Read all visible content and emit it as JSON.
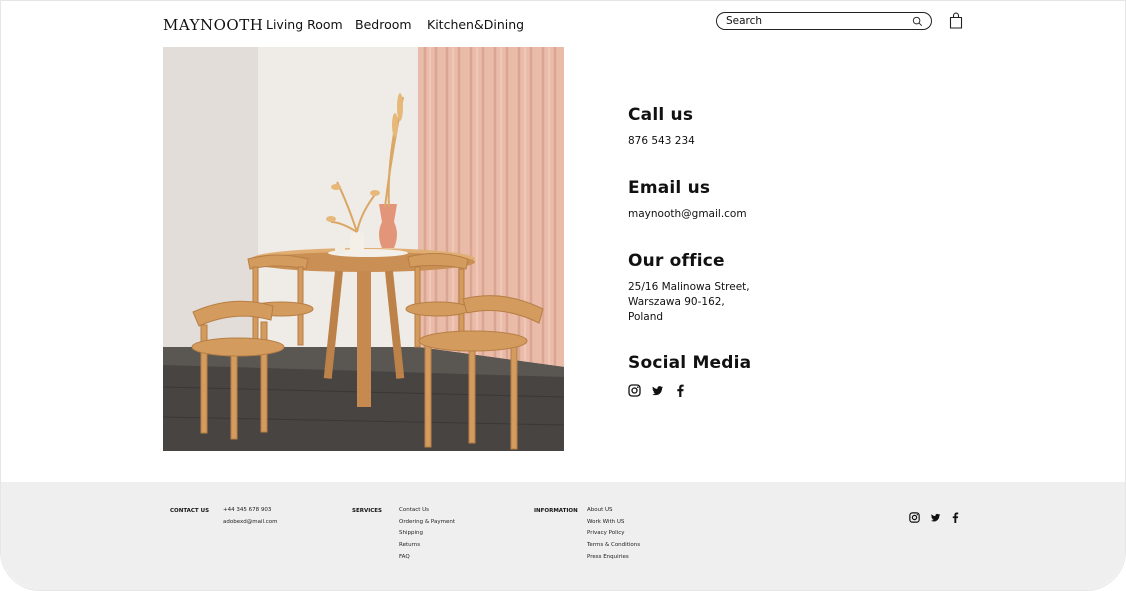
{
  "header": {
    "logo": "MAYNOOTH",
    "nav": [
      {
        "label": "Living Room"
      },
      {
        "label": "Bedroom"
      },
      {
        "label": "Kitchen&Dining"
      }
    ],
    "search": {
      "placeholder": "Search",
      "value": ""
    },
    "icons": {
      "search": "search-icon",
      "cart": "shopping-bag-icon"
    }
  },
  "contact": {
    "call": {
      "heading": "Call us",
      "value": "876 543 234"
    },
    "email": {
      "heading": "Email us",
      "value": "maynooth@gmail.com"
    },
    "office": {
      "heading": "Our office",
      "lines": [
        "25/16 Malinowa Street,",
        "Warszawa 90-162,",
        "Poland"
      ]
    },
    "social": {
      "heading": "Social Media",
      "icons": [
        "instagram-icon",
        "twitter-icon",
        "facebook-icon"
      ]
    }
  },
  "footer": {
    "contact": {
      "heading": "CONTACT US",
      "phone": "+44 345 678 903",
      "email": "adobexd@mail.com"
    },
    "services": {
      "heading": "SERVICES",
      "links": [
        "Contact Us",
        "Ordering & Payment",
        "Shipping",
        "Returns",
        "FAQ"
      ]
    },
    "information": {
      "heading": "INFORMATION",
      "links": [
        "About US",
        "Work With US",
        "Privacy Policy",
        "Terms & Conditions",
        "Press Enquiries"
      ]
    },
    "social_icons": [
      "instagram-icon",
      "twitter-icon",
      "facebook-icon"
    ]
  },
  "colors": {
    "text": "#111111",
    "footer_bg": "#efefef",
    "curtain": "#e8b8a6",
    "wood": "#d9a468",
    "floor": "#3f3d3b"
  }
}
